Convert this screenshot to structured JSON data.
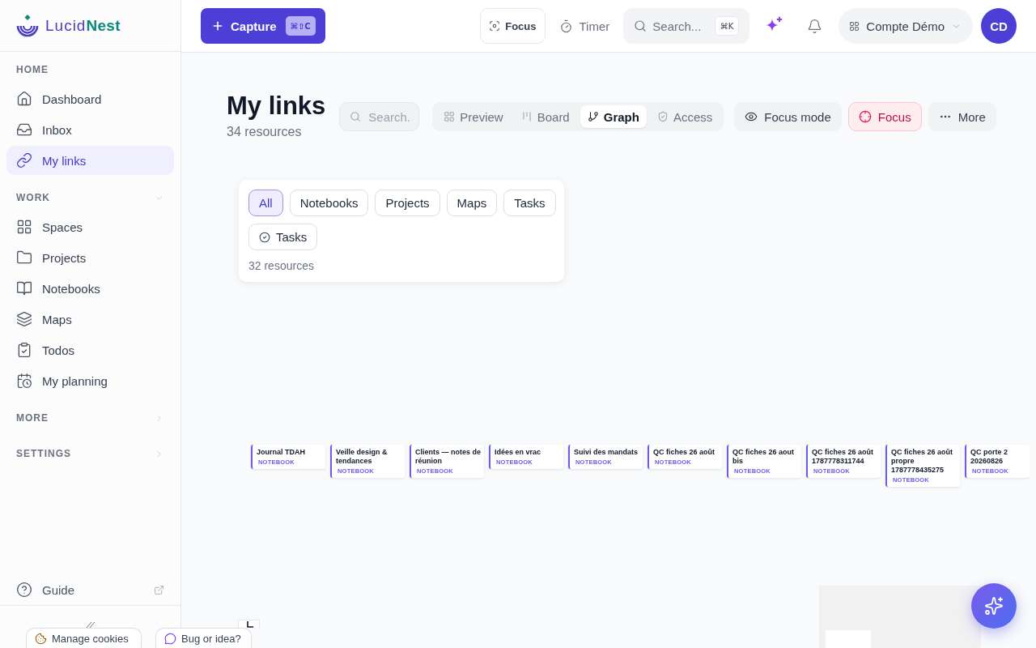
{
  "brand": {
    "primary": "Lucid",
    "accent": "Nest"
  },
  "topbar": {
    "capture": {
      "label": "Capture",
      "shortcut": "⌘⇧C"
    },
    "focus": {
      "label": "Focus"
    },
    "timer": {
      "label": "Timer"
    },
    "search": {
      "placeholder": "Search...",
      "shortcut": "⌘K"
    },
    "account": {
      "label": "Compte Démo"
    },
    "avatar": {
      "initials": "CD"
    }
  },
  "sidebar": {
    "sections": [
      {
        "label": "HOME",
        "kind": "static",
        "expanded": true,
        "items": [
          {
            "label": "Dashboard",
            "selected": false
          },
          {
            "label": "Inbox",
            "selected": false
          },
          {
            "label": "My links",
            "selected": true
          }
        ]
      },
      {
        "label": "WORK",
        "kind": "collapsible",
        "expanded": true,
        "items": [
          {
            "label": "Spaces",
            "selected": false
          },
          {
            "label": "Projects",
            "selected": false
          },
          {
            "label": "Notebooks",
            "selected": false
          },
          {
            "label": "Maps",
            "selected": false
          },
          {
            "label": "Todos",
            "selected": false
          },
          {
            "label": "My planning",
            "selected": false
          }
        ]
      },
      {
        "label": "MORE",
        "kind": "collapsible",
        "expanded": false
      },
      {
        "label": "SETTINGS",
        "kind": "collapsible",
        "expanded": false
      }
    ],
    "footer": {
      "label": "Guide"
    }
  },
  "page": {
    "title": "My links",
    "subtitle": "34 resources",
    "search": {
      "placeholder": "Search."
    },
    "views": [
      {
        "label": "Preview",
        "selected": false
      },
      {
        "label": "Board",
        "selected": false
      },
      {
        "label": "Graph",
        "selected": true
      },
      {
        "label": "Access",
        "selected": false
      }
    ],
    "actions": [
      {
        "label": "Focus mode",
        "kind": "neutral"
      },
      {
        "label": "Focus",
        "kind": "danger"
      },
      {
        "label": "More",
        "kind": "neutral"
      }
    ]
  },
  "filter": {
    "chips": [
      {
        "label": "All",
        "kind": "plain",
        "selected": true
      },
      {
        "label": "Notebooks",
        "kind": "plain",
        "selected": false
      },
      {
        "label": "Projects",
        "kind": "plain",
        "selected": false
      },
      {
        "label": "Maps",
        "kind": "plain",
        "selected": false
      },
      {
        "label": "Tasks",
        "kind": "plain",
        "selected": false
      },
      {
        "label": "Tasks",
        "kind": "icon",
        "selected": false
      }
    ],
    "count": "32 resources"
  },
  "graph": {
    "nodes": [
      {
        "title": "Journal TDAH",
        "type": "NOTEBOOK"
      },
      {
        "title": "Veille design & tendances",
        "type": "NOTEBOOK"
      },
      {
        "title": "Clients — notes de réunion",
        "type": "NOTEBOOK"
      },
      {
        "title": "Idées en vrac",
        "type": "NOTEBOOK"
      },
      {
        "title": "Suivi des mandats",
        "type": "NOTEBOOK"
      },
      {
        "title": "QC fiches 26 août",
        "type": "NOTEBOOK"
      },
      {
        "title": "QC fiches 26 aout bis",
        "type": "NOTEBOOK"
      },
      {
        "title": "QC fiches 26 août 1787778311744",
        "type": "NOTEBOOK"
      },
      {
        "title": "QC fiches 26 août propre 1787778435275",
        "type": "NOTEBOOK"
      },
      {
        "title": "QC porte 2 20260826",
        "type": "NOTEBOOK"
      }
    ]
  },
  "overlays": {
    "cookies": "Manage cookies",
    "feedback": "Bug or idea?"
  }
}
